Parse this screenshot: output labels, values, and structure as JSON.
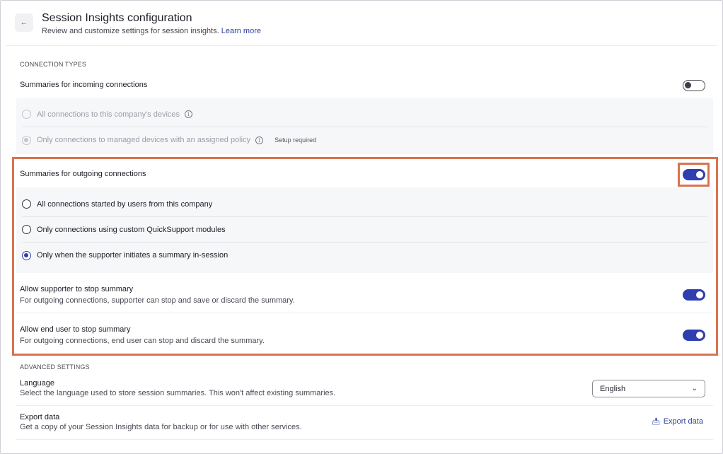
{
  "header": {
    "back_icon": "arrow-left-icon",
    "back_glyph": "←",
    "title": "Session Insights configuration",
    "subtitle": "Review and customize settings for session insights.",
    "learn_more": "Learn more"
  },
  "connection_types": {
    "label": "CONNECTION TYPES",
    "incoming": {
      "title": "Summaries for incoming connections",
      "enabled": false,
      "options": [
        {
          "label": "All connections to this company's devices",
          "checked": false,
          "info": true
        },
        {
          "label": "Only connections to managed devices with an assigned policy",
          "checked": true,
          "info": true,
          "badge": "Setup required"
        }
      ]
    },
    "outgoing": {
      "title": "Summaries for outgoing connections",
      "enabled": true,
      "options": [
        {
          "label": "All connections started by users from this company",
          "checked": false
        },
        {
          "label": "Only connections using custom QuickSupport modules",
          "checked": false
        },
        {
          "label": "Only when the supporter initiates a summary in-session",
          "checked": true
        }
      ]
    },
    "supporter_stop": {
      "title": "Allow supporter to stop summary",
      "desc": "For outgoing connections, supporter can stop and save or discard the summary.",
      "enabled": true
    },
    "end_user_stop": {
      "title": "Allow end user to stop summary",
      "desc": "For outgoing connections, end user can stop and discard the summary.",
      "enabled": true
    }
  },
  "advanced": {
    "label": "ADVANCED SETTINGS",
    "language": {
      "title": "Language",
      "desc": "Select the language used to store session summaries. This won't affect existing summaries.",
      "value": "English"
    },
    "export": {
      "title": "Export data",
      "desc": "Get a copy of your Session Insights data for backup or for use with other services.",
      "button": "Export data",
      "icon": "export-icon"
    }
  },
  "colors": {
    "accent": "#2f3fb0",
    "highlight": "#d9734f",
    "link": "#2b3f9e"
  }
}
